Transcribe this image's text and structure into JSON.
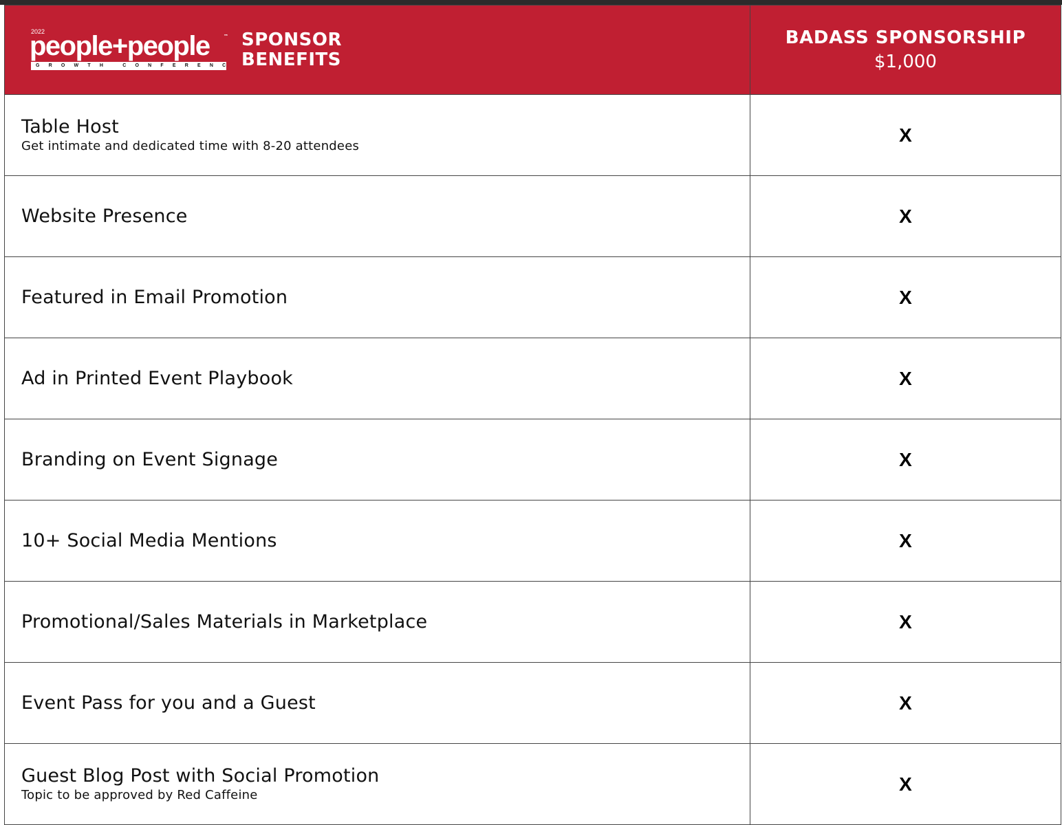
{
  "brand": {
    "year": "2022",
    "wordmark": "people+people",
    "trademark": "™",
    "tagline": "GROWTH CONFERENCE",
    "title_line1": "SPONSOR",
    "title_line2": "BENEFITS",
    "color": "#c01f32"
  },
  "tier": {
    "name": "BADASS SPONSORSHIP",
    "price": "$1,000"
  },
  "rows": [
    {
      "title": "Table Host",
      "subtitle": "Get intimate and dedicated time with 8-20 attendees",
      "mark": "X"
    },
    {
      "title": "Website Presence",
      "subtitle": "",
      "mark": "X"
    },
    {
      "title": "Featured in Email Promotion",
      "subtitle": "",
      "mark": "X"
    },
    {
      "title": "Ad in Printed Event Playbook",
      "subtitle": "",
      "mark": "X"
    },
    {
      "title": "Branding on Event Signage",
      "subtitle": "",
      "mark": "X"
    },
    {
      "title": "10+ Social Media Mentions",
      "subtitle": "",
      "mark": "X"
    },
    {
      "title": "Promotional/Sales Materials in Marketplace",
      "subtitle": "",
      "mark": "X"
    },
    {
      "title": "Event Pass for you and a Guest",
      "subtitle": "",
      "mark": "X"
    },
    {
      "title": "Guest Blog Post with Social Promotion",
      "subtitle": "Topic to be approved by Red Caffeine",
      "mark": "X"
    }
  ]
}
